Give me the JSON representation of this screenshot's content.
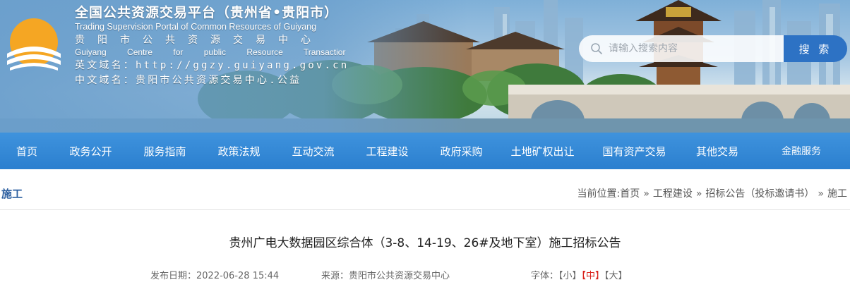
{
  "header": {
    "title_cn": "全国公共资源交易平台（贵州省•贵阳市）",
    "title_en": "Trading Supervision Portal of Common Resources of Guiyang",
    "centre_cn": "贵阳市公共资源交易中心",
    "centre_en": "Guiyang Centre for public Resource Transactior",
    "en_domain": "英文域名：http://ggzy.guiyang.gov.cn",
    "cn_domain": "中文域名：贵阳市公共资源交易中心.公益"
  },
  "search": {
    "placeholder": "请输入搜索内容",
    "button": "搜 索"
  },
  "nav": {
    "items": [
      {
        "label": "首页"
      },
      {
        "label": "政务公开"
      },
      {
        "label": "服务指南"
      },
      {
        "label": "政策法规"
      },
      {
        "label": "互动交流"
      },
      {
        "label": "工程建设"
      },
      {
        "label": "政府采购"
      },
      {
        "label": "土地矿权出让"
      },
      {
        "label": "国有资产交易"
      },
      {
        "label": "其他交易"
      },
      {
        "label": "金融服务"
      }
    ]
  },
  "crumb": {
    "section": "施工",
    "prefix": "当前位置:",
    "items": [
      "首页",
      "工程建设",
      "招标公告（投标邀请书）",
      "施工"
    ],
    "sep": "»"
  },
  "article": {
    "title": "贵州广电大数据园区综合体（3-8、14-19、26#及地下室）施工招标公告",
    "date_label": "发布日期：",
    "date": "2022-06-28 15:44",
    "source_label": "来源：",
    "source": "贵阳市公共资源交易中心",
    "font_label": "字体：",
    "font_small": "【小】",
    "font_medium": "【中】",
    "font_large": "【大】"
  },
  "colors": {
    "nav_bg": "#2b7fcf",
    "search_button": "#2d72c4",
    "section_title": "#2c5fa0",
    "font_active": "#d9201a"
  }
}
